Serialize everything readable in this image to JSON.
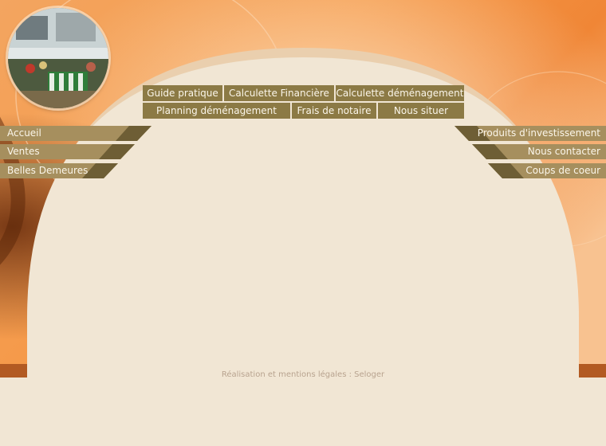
{
  "logo": {
    "alt": "market-photo"
  },
  "top_nav": {
    "row1": [
      {
        "label": "Guide pratique"
      },
      {
        "label": "Calculette Financière"
      },
      {
        "label": "Calculette déménagement"
      }
    ],
    "row2": [
      {
        "label": "Planning déménagement"
      },
      {
        "label": "Frais de notaire"
      },
      {
        "label": "Nous situer"
      }
    ]
  },
  "left_nav": [
    {
      "label": "Accueil"
    },
    {
      "label": "Ventes"
    },
    {
      "label": "Belles Demeures"
    }
  ],
  "right_nav": [
    {
      "label": "Produits d'investissement"
    },
    {
      "label": "Nous contacter"
    },
    {
      "label": "Coups de coeur"
    }
  ],
  "footer": {
    "text": "Réalisation et mentions légales : Seloger"
  },
  "colors": {
    "orange": "#f08a3c",
    "cream": "#f1e6d4",
    "button": "#8c7a45",
    "footer_text": "#b8a38f"
  }
}
